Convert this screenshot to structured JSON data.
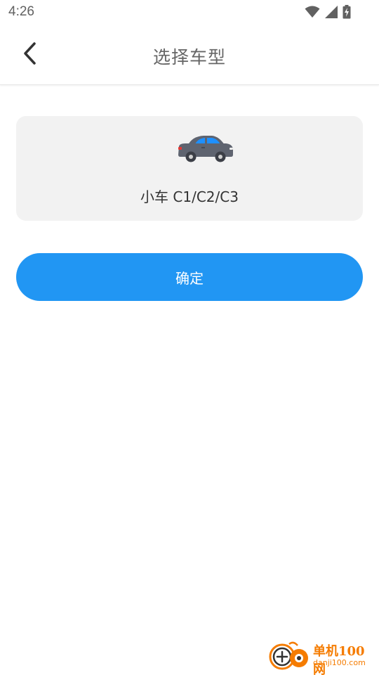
{
  "status_bar": {
    "time": "4:26",
    "icons": [
      "wifi-icon",
      "signal-icon",
      "battery-charging-icon"
    ]
  },
  "app_bar": {
    "back_icon": "chevron-left-icon",
    "title": "选择车型"
  },
  "vehicle_option": {
    "icon": "car-icon",
    "label": "小车 C1/C2/C3"
  },
  "confirm_button": {
    "label": "确定"
  },
  "colors": {
    "primary": "#2196f3",
    "card_background": "#f2f2f2",
    "car_body": "#5f6470",
    "car_window": "#1e90ff",
    "watermark": "#f57c00"
  },
  "watermark": {
    "title": "单机100网",
    "url": "danji100.com"
  }
}
